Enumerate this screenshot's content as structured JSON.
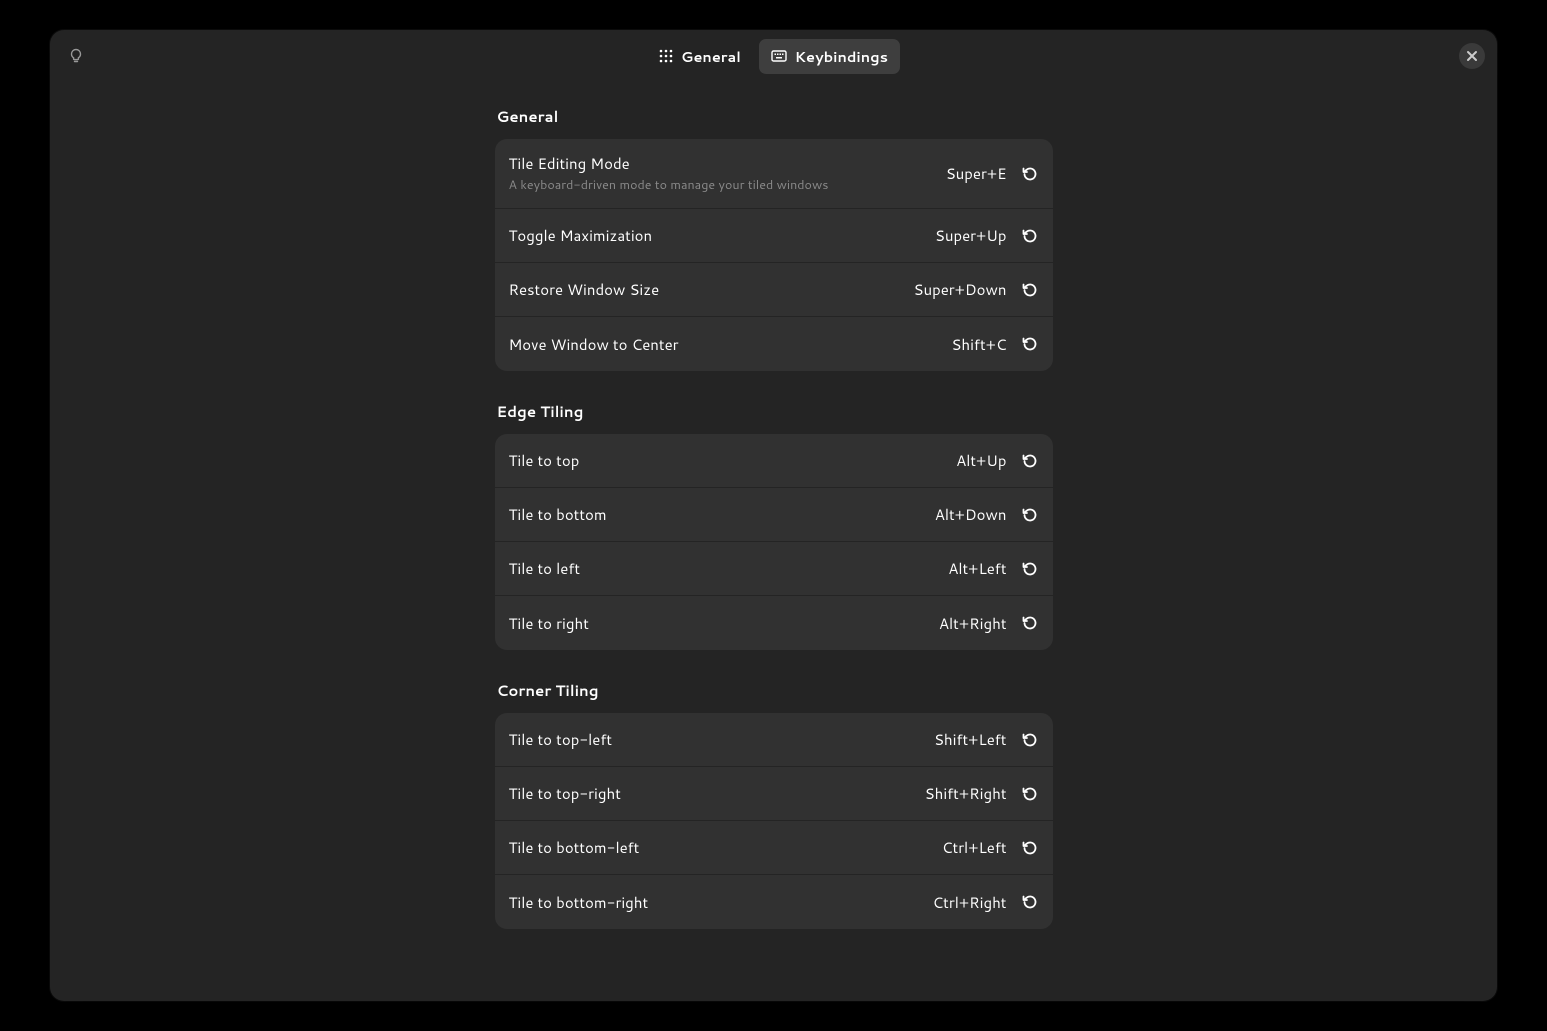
{
  "header": {
    "tabs": [
      {
        "label": "General",
        "icon": "grid-icon",
        "active": false
      },
      {
        "label": "Keybindings",
        "icon": "keyboard-icon",
        "active": true
      }
    ]
  },
  "sections": [
    {
      "title": "General",
      "rows": [
        {
          "title": "Tile Editing Mode",
          "subtitle": "A keyboard-driven mode to manage your tiled windows",
          "accel": "Super+E"
        },
        {
          "title": "Toggle Maximization",
          "subtitle": "",
          "accel": "Super+Up"
        },
        {
          "title": "Restore Window Size",
          "subtitle": "",
          "accel": "Super+Down"
        },
        {
          "title": "Move Window to Center",
          "subtitle": "",
          "accel": "Shift+C"
        }
      ]
    },
    {
      "title": "Edge Tiling",
      "rows": [
        {
          "title": "Tile to top",
          "subtitle": "",
          "accel": "Alt+Up"
        },
        {
          "title": "Tile to bottom",
          "subtitle": "",
          "accel": "Alt+Down"
        },
        {
          "title": "Tile to left",
          "subtitle": "",
          "accel": "Alt+Left"
        },
        {
          "title": "Tile to right",
          "subtitle": "",
          "accel": "Alt+Right"
        }
      ]
    },
    {
      "title": "Corner Tiling",
      "rows": [
        {
          "title": "Tile to top-left",
          "subtitle": "",
          "accel": "Shift+Left"
        },
        {
          "title": "Tile to top-right",
          "subtitle": "",
          "accel": "Shift+Right"
        },
        {
          "title": "Tile to bottom-left",
          "subtitle": "",
          "accel": "Ctrl+Left"
        },
        {
          "title": "Tile to bottom-right",
          "subtitle": "",
          "accel": "Ctrl+Right"
        }
      ]
    }
  ]
}
